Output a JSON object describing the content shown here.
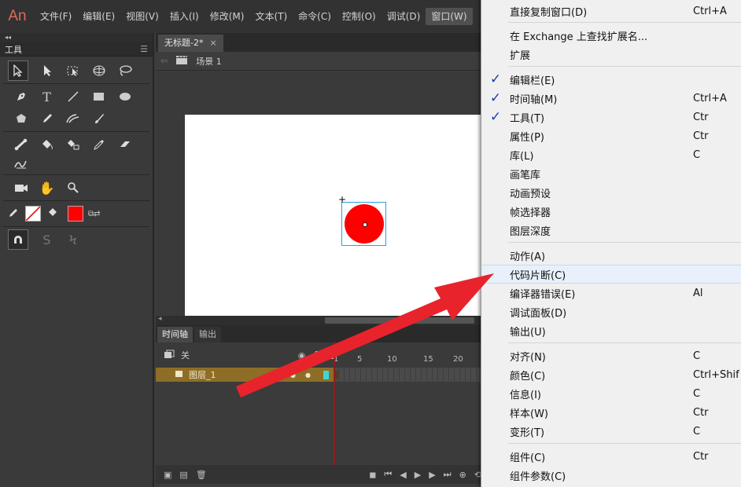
{
  "app": {
    "logo": "An",
    "menus": [
      "文件(F)",
      "编辑(E)",
      "视图(V)",
      "插入(I)",
      "修改(M)",
      "文本(T)",
      "命令(C)",
      "控制(O)",
      "调试(D)",
      "窗口(W)"
    ],
    "active_menu_index": 9
  },
  "tools": {
    "collapse": "◂◂",
    "title": "工具",
    "rows": [
      [
        "selection-arrow",
        "subselection-arrow",
        "free-transform",
        "3d-rotation",
        "lasso"
      ],
      [
        "pen",
        "text",
        "line",
        "rectangle",
        "oval"
      ],
      [
        "polystar",
        "pencil",
        "paint-brush",
        "brush"
      ],
      [
        "bone",
        "paint-bucket",
        "ink-bottle",
        "eyedropper",
        "eraser"
      ],
      [
        "width"
      ],
      [
        "camera",
        "hand",
        "zoom"
      ]
    ],
    "stroke_color": "none",
    "fill_color": "#ff0000"
  },
  "document": {
    "tab_label": "无标题-2*",
    "tab_close": "×",
    "scene_label": "场景 1"
  },
  "timeline": {
    "tabs": [
      "时间轴",
      "输出"
    ],
    "header_label": "关",
    "ruler": [
      "1",
      "5",
      "10",
      "15",
      "20"
    ],
    "layer_name": "图层_1"
  },
  "window_menu": {
    "items": [
      {
        "label": "直接复制窗口(D)",
        "shortcut": "Ctrl+A",
        "checked": false
      },
      {
        "label": "在 Exchange 上查找扩展名...",
        "shortcut": "",
        "checked": false
      },
      {
        "label": "扩展",
        "shortcut": "",
        "checked": false
      },
      {
        "label": "编辑栏(E)",
        "shortcut": "",
        "checked": true
      },
      {
        "label": "时间轴(M)",
        "shortcut": "Ctrl+A",
        "checked": true
      },
      {
        "label": "工具(T)",
        "shortcut": "Ctr",
        "checked": true
      },
      {
        "label": "属性(P)",
        "shortcut": "Ctr",
        "checked": false
      },
      {
        "label": "库(L)",
        "shortcut": "C",
        "checked": false
      },
      {
        "label": "画笔库",
        "shortcut": "",
        "checked": false
      },
      {
        "label": "动画预设",
        "shortcut": "",
        "checked": false
      },
      {
        "label": "帧选择器",
        "shortcut": "",
        "checked": false
      },
      {
        "label": "图层深度",
        "shortcut": "",
        "checked": false
      },
      {
        "label": "动作(A)",
        "shortcut": "",
        "checked": false
      },
      {
        "label": "代码片断(C)",
        "shortcut": "",
        "checked": false
      },
      {
        "label": "编译器错误(E)",
        "shortcut": "Al",
        "checked": false
      },
      {
        "label": "调试面板(D)",
        "shortcut": "",
        "checked": false
      },
      {
        "label": "输出(U)",
        "shortcut": "",
        "checked": false
      },
      {
        "label": "对齐(N)",
        "shortcut": "C",
        "checked": false
      },
      {
        "label": "颜色(C)",
        "shortcut": "Ctrl+Shif",
        "checked": false
      },
      {
        "label": "信息(I)",
        "shortcut": "C",
        "checked": false
      },
      {
        "label": "样本(W)",
        "shortcut": "Ctr",
        "checked": false
      },
      {
        "label": "变形(T)",
        "shortcut": "C",
        "checked": false
      },
      {
        "label": "组件(C)",
        "shortcut": "Ctr",
        "checked": false
      },
      {
        "label": "组件参数(C)",
        "shortcut": "",
        "checked": false
      }
    ],
    "highlighted_index": 13,
    "check_mark": "✓",
    "check_color": "#1d3bb0"
  },
  "annotation": {
    "arrow_color": "#e8232c"
  }
}
